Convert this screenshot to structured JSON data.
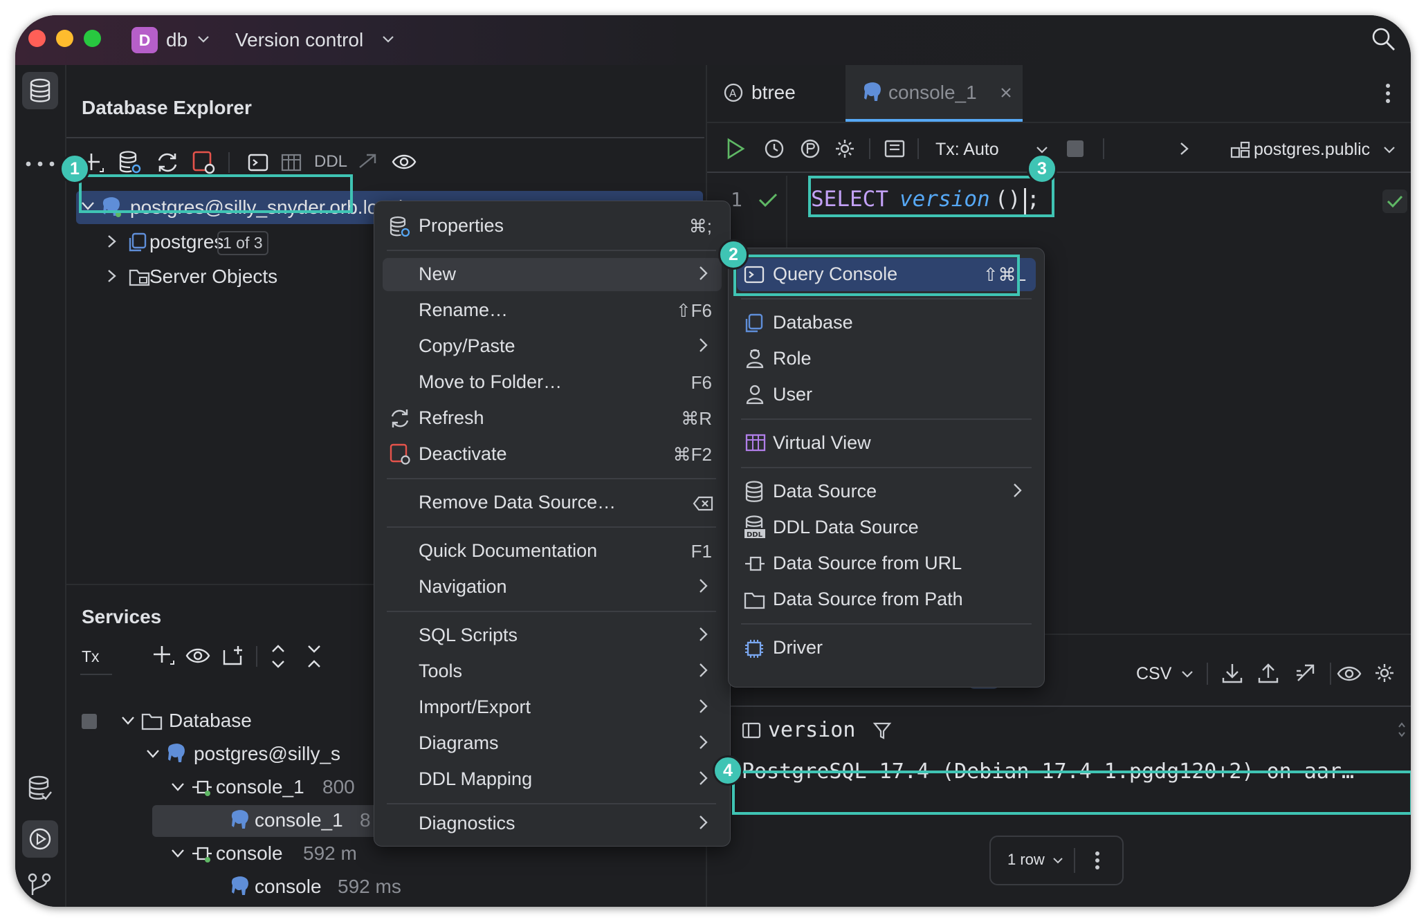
{
  "titlebar": {
    "project_letter": "D",
    "project_name": "db",
    "vcs_label": "Version control"
  },
  "db_explorer": {
    "title": "Database Explorer",
    "toolbar_ddl": "DDL",
    "tree": {
      "datasource": "postgres@silly_snyder.orb.local",
      "datasource_count": "1",
      "db_name": "postgres",
      "db_badge": "1 of 3",
      "server_objects": "Server Objects"
    }
  },
  "services": {
    "title": "Services",
    "tx_label": "Tx",
    "tree": {
      "database": "Database",
      "datasource": "postgres@silly_s",
      "session1": "console_1",
      "session1_time": "800",
      "console1": "console_1",
      "console1_time": "8",
      "session2": "console",
      "session2_time": "592 m",
      "console2": "console",
      "console2_time": "592 ms"
    }
  },
  "editor": {
    "tabs": [
      {
        "label": "btree"
      },
      {
        "label": "console_1"
      }
    ],
    "tx_mode": "Tx: Auto",
    "schema": "postgres.public",
    "line_number": "1",
    "code_keyword": "SELECT",
    "code_function": "version",
    "code_parens": "()",
    "code_semicolon": ";"
  },
  "context_menu": {
    "items": [
      {
        "label": "Properties",
        "shortcut": "⌘;"
      },
      {
        "label": "New"
      },
      {
        "label": "Rename…",
        "shortcut": "⇧F6"
      },
      {
        "label": "Copy/Paste"
      },
      {
        "label": "Move to Folder…",
        "shortcut": "F6"
      },
      {
        "label": "Refresh",
        "shortcut": "⌘R"
      },
      {
        "label": "Deactivate",
        "shortcut": "⌘F2"
      },
      {
        "label": "Remove Data Source…"
      },
      {
        "label": "Quick Documentation",
        "shortcut": "F1"
      },
      {
        "label": "Navigation"
      },
      {
        "label": "SQL Scripts"
      },
      {
        "label": "Tools"
      },
      {
        "label": "Import/Export"
      },
      {
        "label": "Diagrams"
      },
      {
        "label": "DDL Mapping"
      },
      {
        "label": "Diagnostics"
      }
    ]
  },
  "submenu": {
    "items": [
      {
        "label": "Query Console",
        "shortcut": "⇧⌘L"
      },
      {
        "label": "Database"
      },
      {
        "label": "Role"
      },
      {
        "label": "User"
      },
      {
        "label": "Virtual View"
      },
      {
        "label": "Data Source"
      },
      {
        "label": "DDL Data Source"
      },
      {
        "label": "Data Source from URL"
      },
      {
        "label": "Data Source from Path"
      },
      {
        "label": "Driver"
      }
    ]
  },
  "results": {
    "format": "CSV",
    "column": "version",
    "value": "PostgreSQL 17.4 (Debian 17.4-1.pgdg120+2) on aar…",
    "row_count": "1 row"
  },
  "callouts": [
    "1",
    "2",
    "3",
    "4"
  ],
  "colors": {
    "accent": "#3fc4b4",
    "background": "#1e1f22",
    "panel": "#2b2d30",
    "keyword": "#c3a1f7",
    "function": "#56a8f5"
  }
}
